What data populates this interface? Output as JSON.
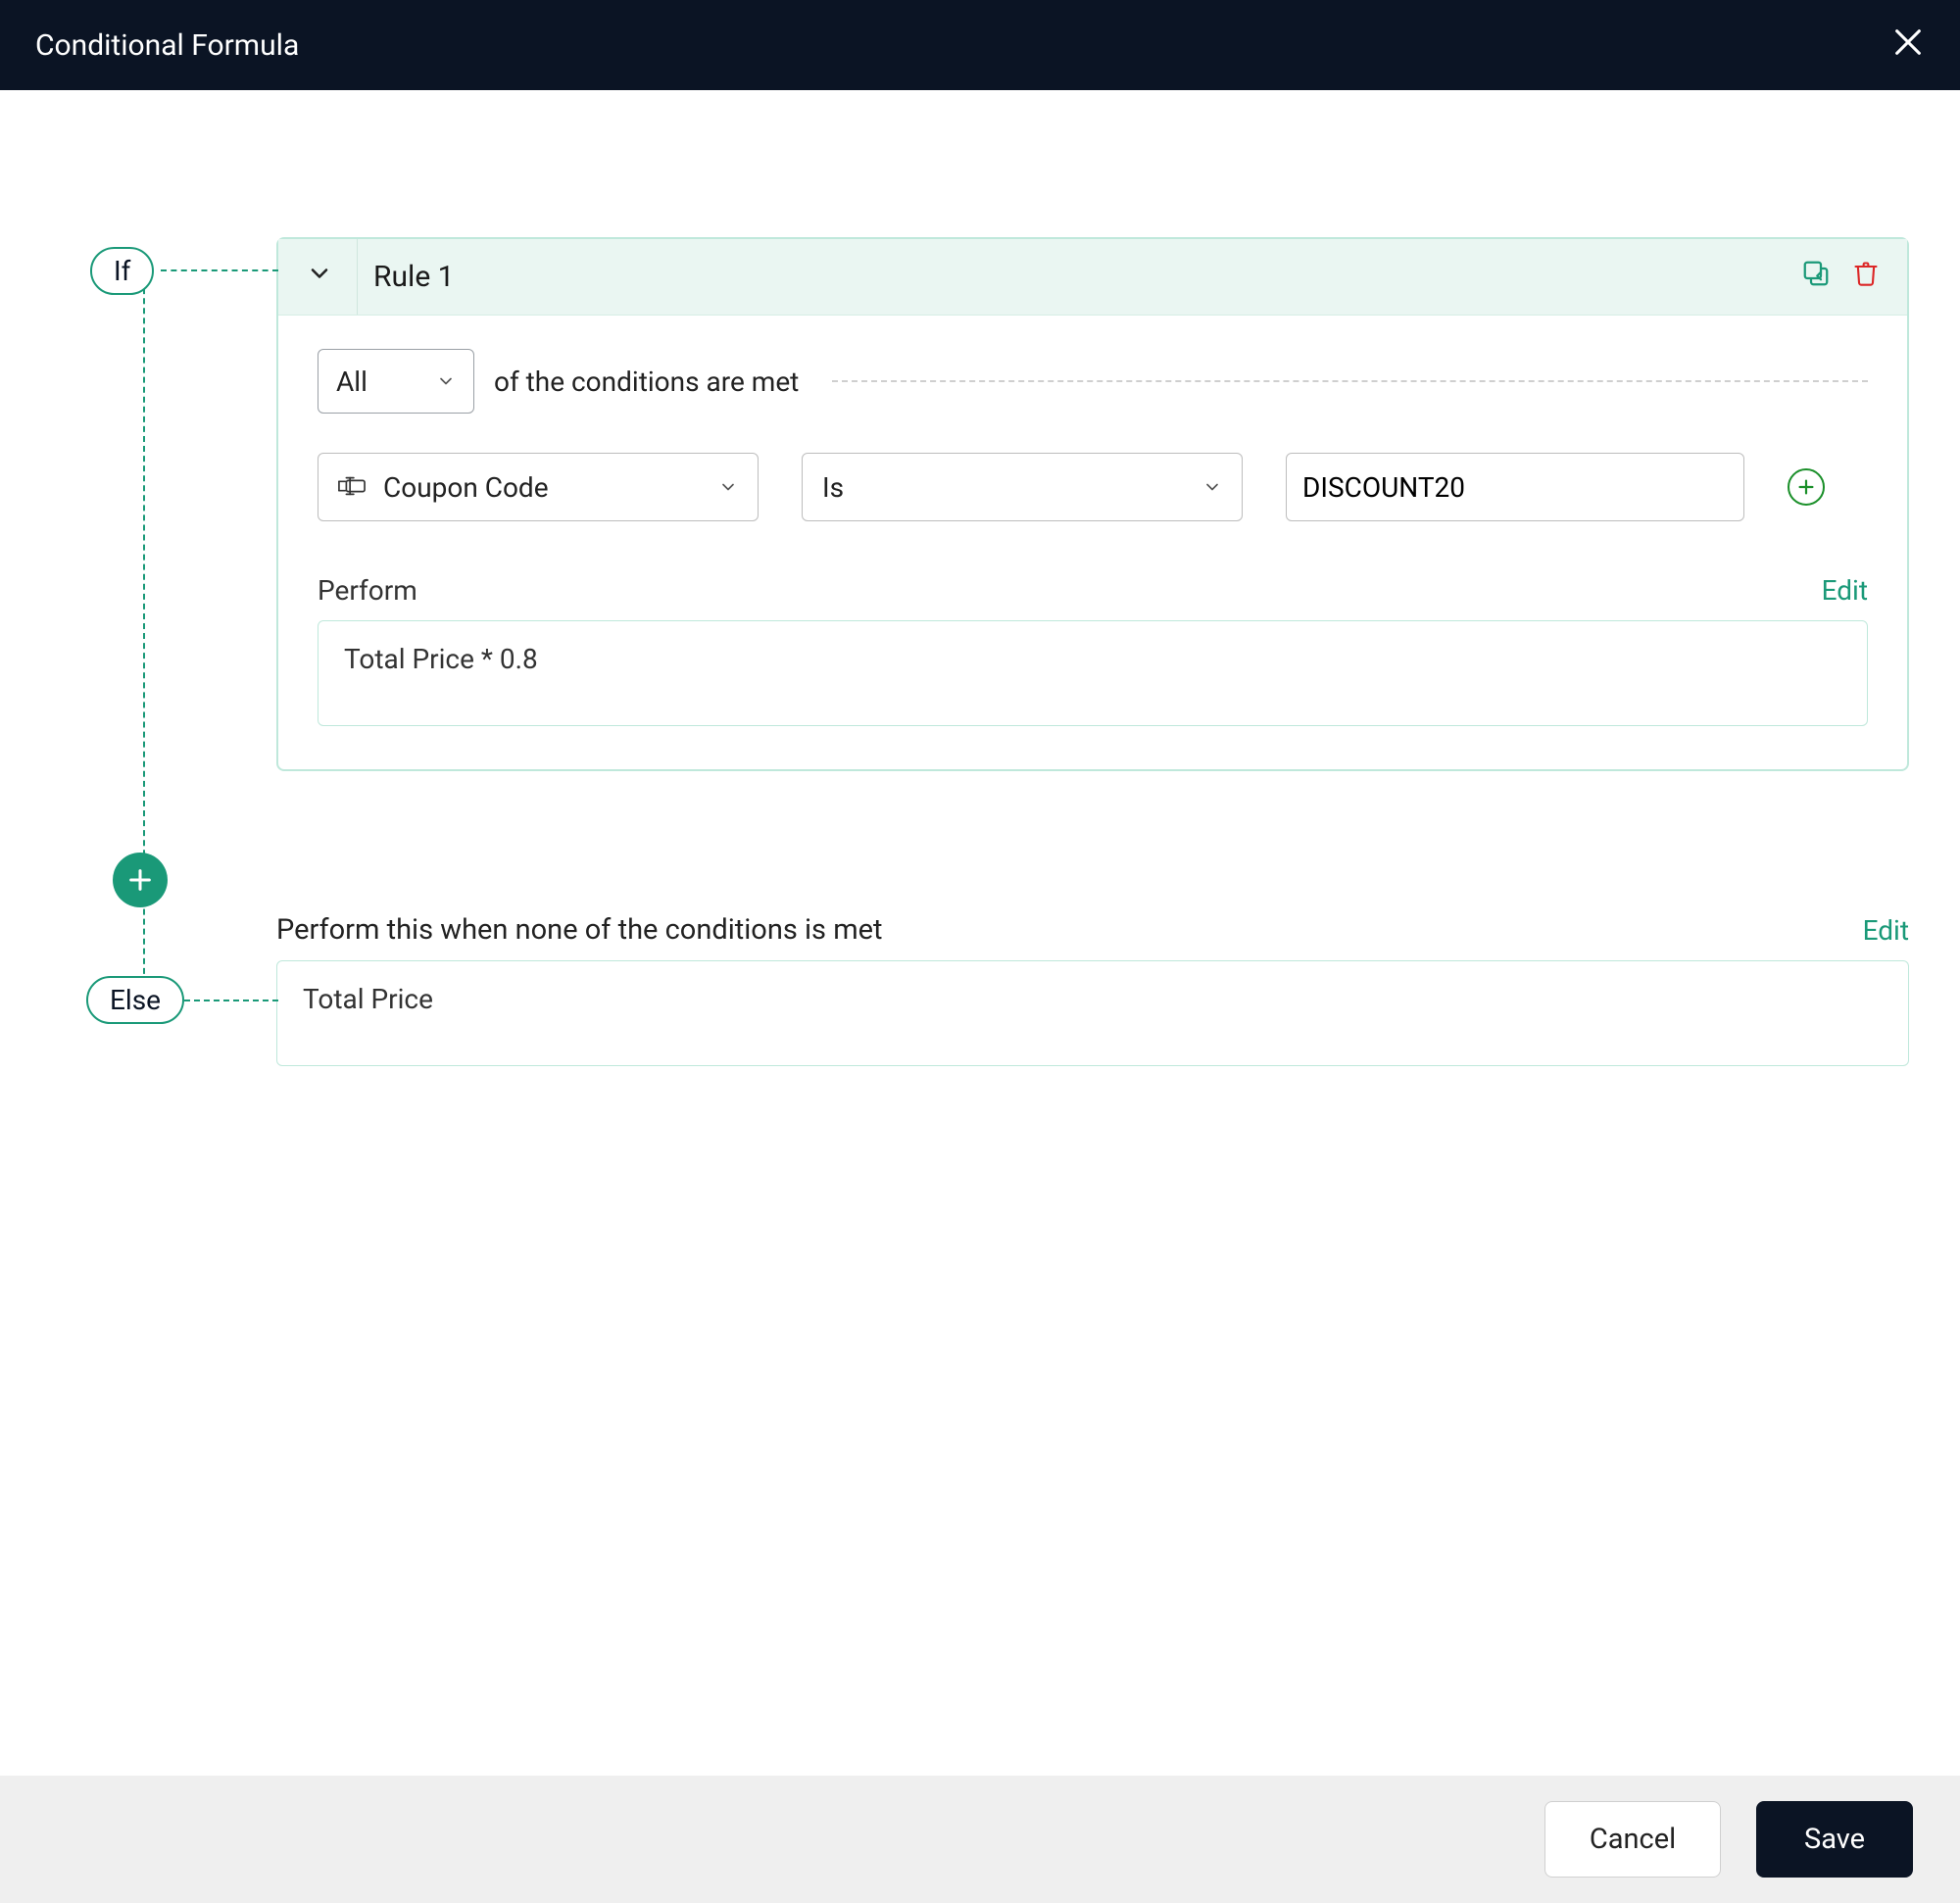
{
  "header": {
    "title": "Conditional Formula"
  },
  "branches": {
    "if_label": "If",
    "else_label": "Else"
  },
  "rule": {
    "title": "Rule 1",
    "matcher": {
      "mode": "All",
      "suffix_text": "of the conditions are met"
    },
    "condition": {
      "field": "Coupon Code",
      "operator": "Is",
      "value": "DISCOUNT20"
    },
    "perform_label": "Perform",
    "edit_label": "Edit",
    "formula": "Total Price * 0.8"
  },
  "else_block": {
    "description": "Perform this when none of the conditions is met",
    "edit_label": "Edit",
    "formula": "Total Price"
  },
  "footer": {
    "cancel": "Cancel",
    "save": "Save"
  },
  "colors": {
    "accent": "#1a9978",
    "header_bg": "#0b1424",
    "danger": "#dc2626"
  }
}
